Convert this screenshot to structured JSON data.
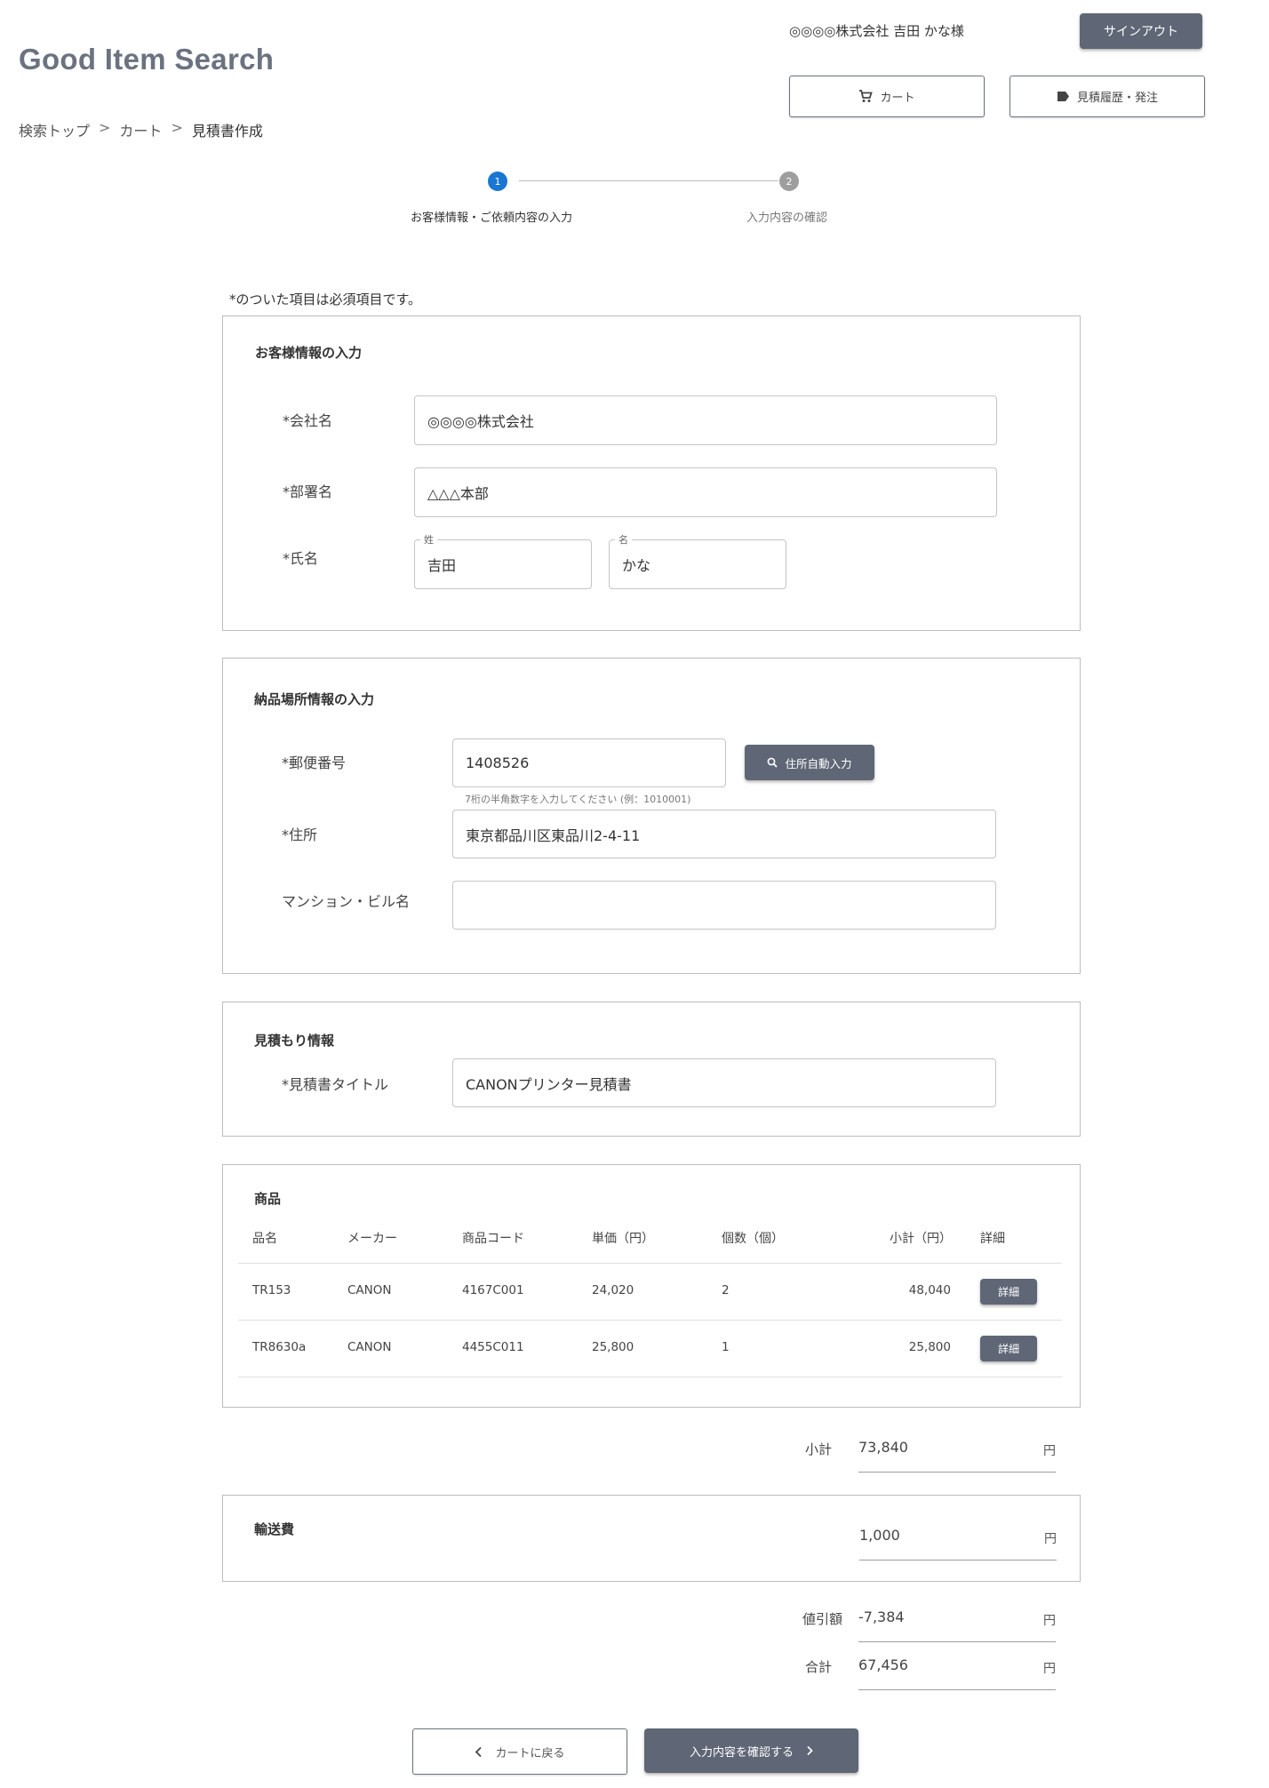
{
  "header": {
    "logo": "Good Item Search",
    "user": "◎◎◎◎株式会社 吉田 かな様",
    "signout_label": "サインアウト",
    "cart_label": "カート",
    "history_label": "見積履歴・発注"
  },
  "breadcrumb": [
    "検索トップ",
    ">",
    "カート",
    ">",
    "見積書作成"
  ],
  "stepper": {
    "steps": [
      {
        "num": "1",
        "label": "お客様情報・ご依頼内容の入力"
      },
      {
        "num": "2",
        "label": "入力内容の確認"
      }
    ]
  },
  "required_note": "*のついた項目は必須項目です。",
  "customer": {
    "title": "お客様情報の入力",
    "company_label": "*会社名",
    "company_value": "◎◎◎◎株式会社",
    "dept_label": "*部署名",
    "dept_value": "△△△本部",
    "name_label": "*氏名",
    "last_legend": "姓",
    "last_value": "吉田",
    "first_legend": "名",
    "first_value": "かな"
  },
  "delivery": {
    "title": "納品場所情報の入力",
    "zip_label": "*郵便番号",
    "zip_value": "1408526",
    "zip_hint": "7桁の半角数字を入力してください (例：1010001)",
    "autofill_label": "住所自動入力",
    "address_label": "*住所",
    "address_value": "東京都品川区東品川2-4-11",
    "building_label": "マンション・ビル名",
    "building_value": ""
  },
  "estimate": {
    "title": "見積もり情報",
    "title_label": "*見積書タイトル",
    "title_value": "CANONプリンター見積書"
  },
  "products": {
    "title": "商品",
    "headers": [
      "品名",
      "メーカー",
      "商品コード",
      "単価（円）",
      "個数（個）",
      "小計（円）",
      "詳細"
    ],
    "rows": [
      {
        "name": "TR153",
        "maker": "CANON",
        "code": "4167C001",
        "price": "24,020",
        "qty": "2",
        "subtotal": "48,040",
        "detail": "詳細"
      },
      {
        "name": "TR8630a",
        "maker": "CANON",
        "code": "4455C011",
        "price": "25,800",
        "qty": "1",
        "subtotal": "25,800",
        "detail": "詳細"
      }
    ]
  },
  "summary": {
    "subtotal_label": "小計",
    "subtotal_value": "73,840",
    "shipping_title": "輸送費",
    "shipping_value": "1,000",
    "discount_label": "値引額",
    "discount_value": "-7,384",
    "total_label": "合計",
    "total_value": "67,456",
    "yen": "円"
  },
  "footer": {
    "back_label": "カートに戻る",
    "confirm_label": "入力内容を確認する"
  },
  "colors": {
    "accent": "#1976d2",
    "button": "#5f6776",
    "inactive_step": "#9e9e9e"
  }
}
